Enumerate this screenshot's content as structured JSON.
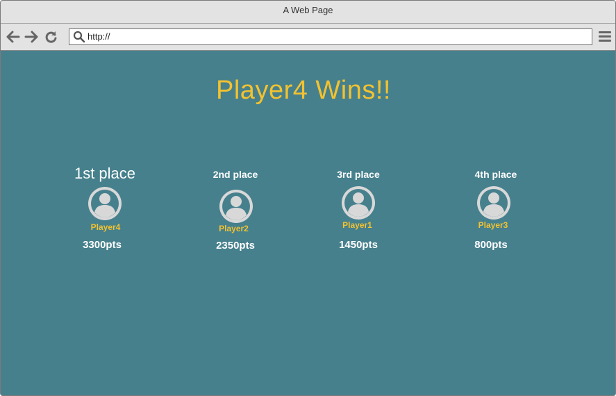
{
  "window": {
    "title": "A Web Page"
  },
  "toolbar": {
    "url": "http://",
    "back_icon": "arrow-left-icon",
    "forward_icon": "arrow-right-icon",
    "reload_icon": "reload-icon",
    "menu_icon": "hamburger-menu-icon"
  },
  "headline": "Player4 Wins!!",
  "colors": {
    "background": "#46808d",
    "accent": "#f2c230",
    "chrome": "#e3e3e3"
  },
  "standings": [
    {
      "place": "1st place",
      "player": "Player4",
      "points": "3300pts"
    },
    {
      "place": "2nd place",
      "player": "Player2",
      "points": "2350pts"
    },
    {
      "place": "3rd place",
      "player": "Player1",
      "points": "1450pts"
    },
    {
      "place": "4th place",
      "player": "Player3",
      "points": "800pts"
    }
  ]
}
